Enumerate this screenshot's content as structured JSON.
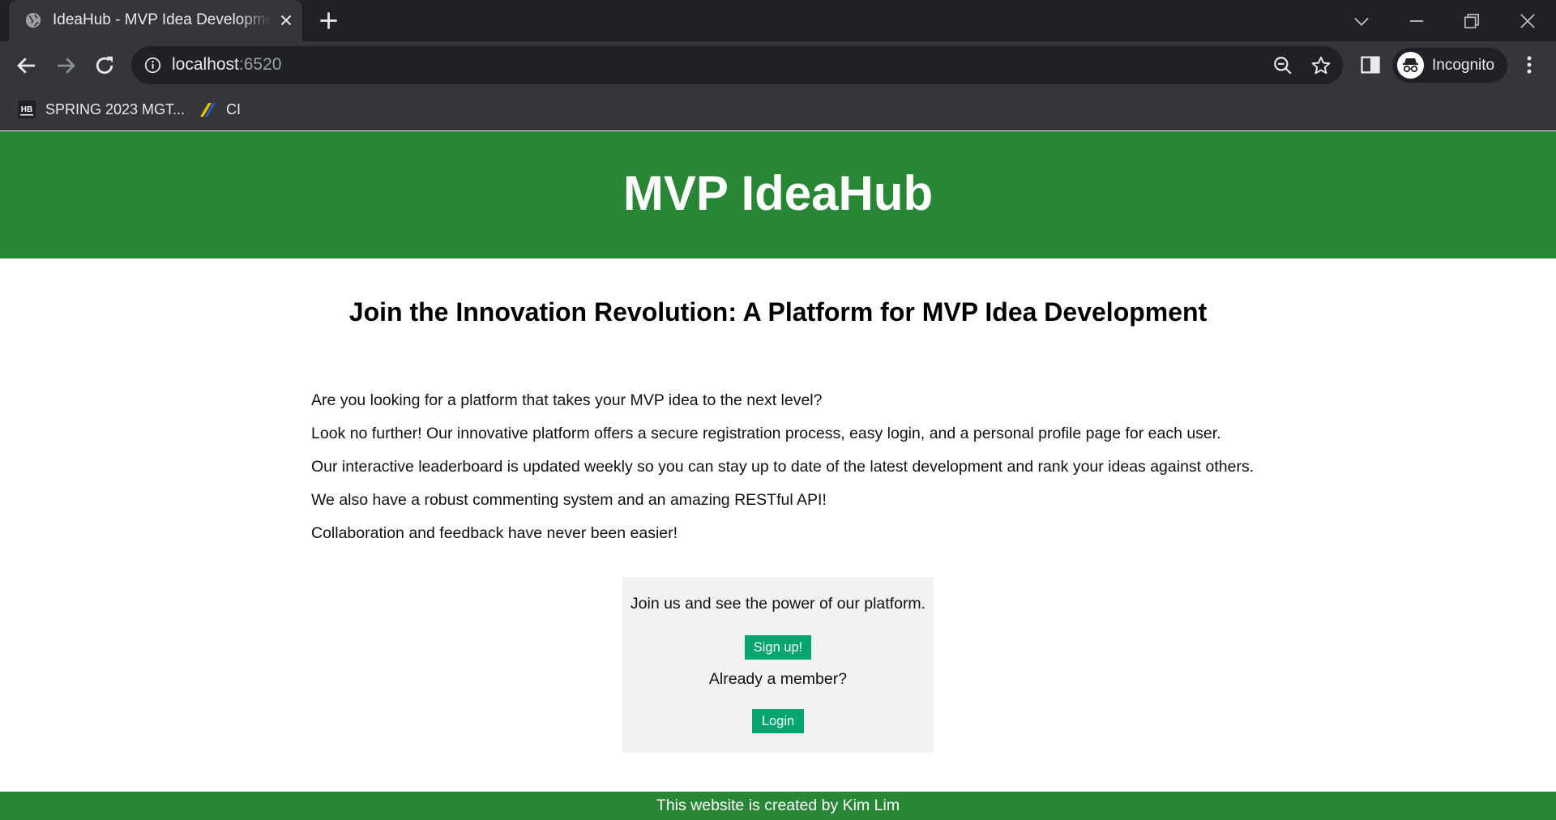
{
  "browser": {
    "tab_title": "IdeaHub - MVP Idea Development",
    "url_host": "localhost",
    "url_port": ":6520",
    "profile_label": "Incognito",
    "bookmarks": [
      {
        "label": "SPRING 2023 MGT...",
        "icon": "hb-icon"
      },
      {
        "label": "CI",
        "icon": "ci-stripes-icon"
      }
    ],
    "colors": {
      "tabstrip": "#202124",
      "toolbar": "#35363a",
      "text": "#e8eaed"
    }
  },
  "site": {
    "title": "MVP IdeaHub",
    "headline": "Join the Innovation Revolution: A Platform for MVP Idea Development",
    "intro": [
      "Are you looking for a platform that takes your MVP idea to the next level?",
      "Look no further! Our innovative platform offers a secure registration process, easy login, and a personal profile page for each user.",
      "Our interactive leaderboard is updated weekly so you can stay up to date of the latest development and rank your ideas against others.",
      "We also have a robust commenting system and an amazing RESTful API!",
      "Collaboration and feedback have never been easier!"
    ],
    "cta": {
      "join_text": "Join us and see the power of our platform.",
      "signup_label": "Sign up!",
      "member_text": "Already a member?",
      "login_label": "Login"
    },
    "footer": "This website is created by Kim Lim",
    "colors": {
      "brand_green": "#278734",
      "button_green": "#06a46e",
      "cta_bg": "#f2f2f2"
    }
  }
}
